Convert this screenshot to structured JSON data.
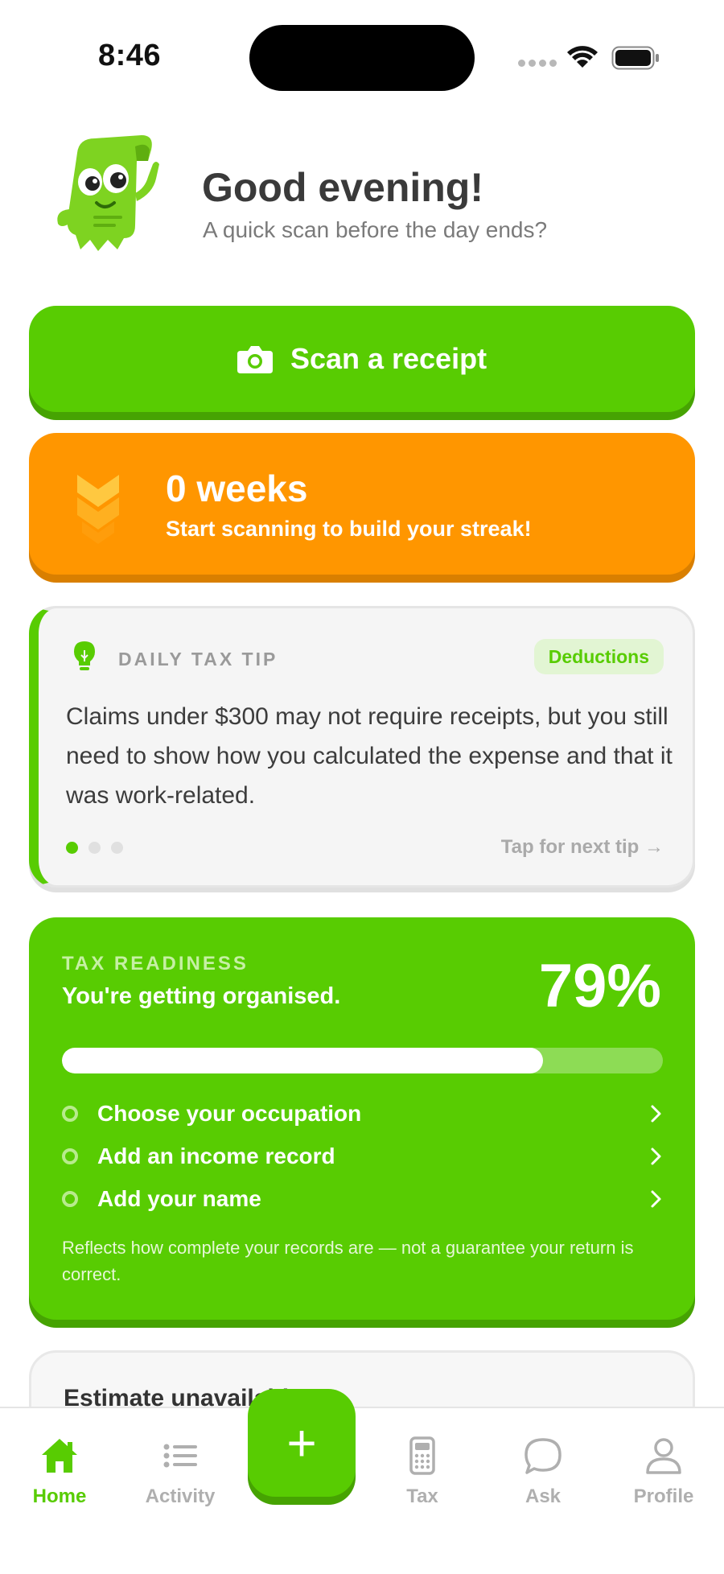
{
  "status_bar": {
    "time": "8:46"
  },
  "greeting": {
    "title": "Good evening!",
    "subtitle": "A quick scan before the day ends?"
  },
  "scan_button": {
    "label": "Scan a receipt",
    "icon": "camera-icon"
  },
  "streak": {
    "title": "0 weeks",
    "subtitle": "Start scanning to build your streak!",
    "icon": "chevrons-down-icon"
  },
  "tip": {
    "kicker": "DAILY TAX TIP",
    "badge": "Deductions",
    "text": "Claims under $300 may not require receipts, but you still need to show how you calculated the expense and that it was work-related.",
    "next_label": "Tap for next tip →",
    "page_count": 3,
    "active_page": 1
  },
  "tax_readiness": {
    "kicker": "TAX READINESS",
    "subtitle": "You're getting organised.",
    "percent_label": "79%",
    "progress": 0.8,
    "items": [
      {
        "label": "Choose your occupation"
      },
      {
        "label": "Add an income record"
      },
      {
        "label": "Add your name"
      }
    ],
    "note": "Reflects how complete your records are — not a guarantee your return is correct."
  },
  "estimate": {
    "title": "Estimate unavailable"
  },
  "tabbar": {
    "tabs": [
      {
        "label": "Home",
        "icon": "home-icon",
        "active": true
      },
      {
        "label": "Activity",
        "icon": "list-icon",
        "active": false
      },
      {
        "label": "Tax",
        "icon": "calculator-icon",
        "active": false
      },
      {
        "label": "Ask",
        "icon": "chat-bubble-icon",
        "active": false
      },
      {
        "label": "Profile",
        "icon": "person-icon",
        "active": false
      }
    ],
    "fab_icon": "plus-icon",
    "fab_symbol": "+"
  },
  "colors": {
    "primary_green": "#58cc02",
    "streak_orange": "#ff9600",
    "muted_gray": "#afafaf"
  }
}
